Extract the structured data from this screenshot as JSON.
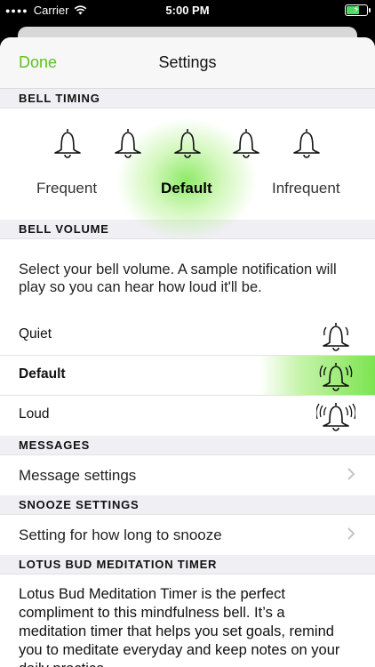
{
  "status": {
    "carrier": "Carrier",
    "time": "5:00 PM"
  },
  "navbar": {
    "done_label": "Done",
    "title": "Settings"
  },
  "bell_timing": {
    "header": "BELL TIMING",
    "labels": {
      "frequent": "Frequent",
      "default": "Default",
      "infrequent": "Infrequent"
    },
    "selected": "Default",
    "bell_count": 5
  },
  "bell_volume": {
    "header": "BELL VOLUME",
    "description": "Select your bell volume.  A sample notification will play so you can hear how loud it'll be.",
    "options": [
      {
        "label": "Quiet"
      },
      {
        "label": "Default"
      },
      {
        "label": "Loud"
      }
    ],
    "selected": "Default"
  },
  "messages": {
    "header": "MESSAGES",
    "row_label": "Message settings"
  },
  "snooze": {
    "header": "SNOOZE SETTINGS",
    "row_label": "Setting for how long to snooze"
  },
  "lotus": {
    "header": "LOTUS BUD MEDITATION TIMER",
    "body": "Lotus Bud Meditation Timer is the perfect compliment to this mindfulness bell.  It’s a meditation timer that helps you set goals, remind you to meditate everyday and keep notes on your daily practice."
  },
  "colors": {
    "accent": "#5dc21e",
    "selection_glow": "#6ee13c",
    "section_bg": "#efeff4"
  },
  "icons": [
    "wifi-icon",
    "battery-icon",
    "bell-icon",
    "chevron-right-icon"
  ]
}
